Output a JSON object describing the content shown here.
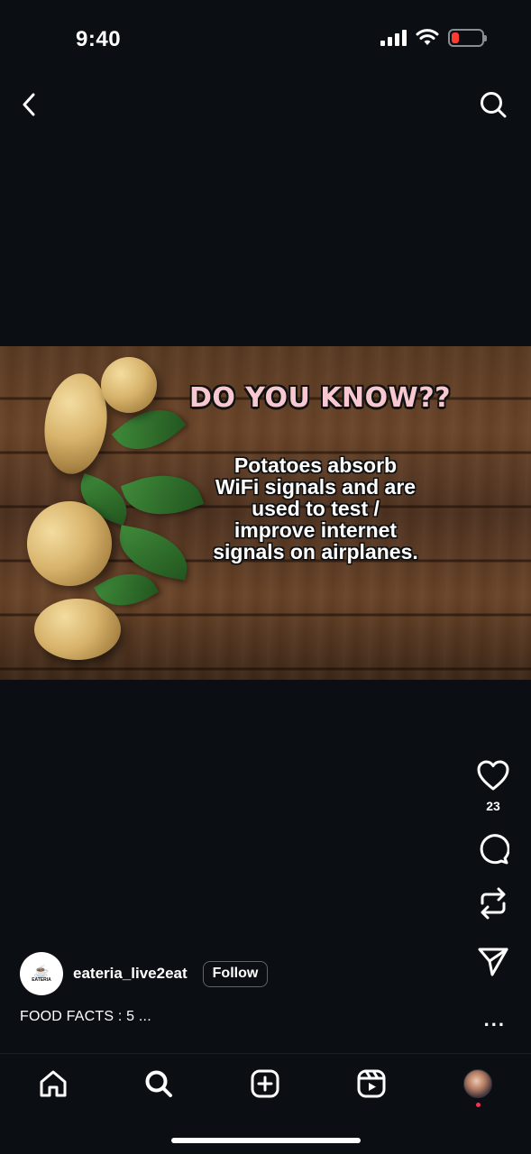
{
  "status_bar": {
    "time": "9:40",
    "icons": [
      "cellular-signal-icon",
      "wifi-icon",
      "battery-low-icon"
    ],
    "battery_color": "#ff3b30"
  },
  "top_nav": {
    "icons": [
      "chevron-left-icon",
      "search-icon"
    ]
  },
  "post_image": {
    "headline": "DO YOU KNOW??",
    "fact": "Potatoes absorb WiFi signals and are used to test / improve internet signals on airplanes.",
    "headline_color": "#f7c8cf"
  },
  "actions": {
    "like_count": "23",
    "icons": [
      "heart-icon",
      "comment-icon",
      "repost-icon",
      "send-icon"
    ]
  },
  "author": {
    "username": "eateria_live2eat",
    "follow_label": "Follow",
    "avatar_text": "EATERIA"
  },
  "caption": "FOOD FACTS : 5 ...",
  "more_label": "...",
  "tab_bar": {
    "icons": [
      "home-icon",
      "search-icon",
      "create-icon",
      "reels-icon",
      "profile-icon"
    ],
    "notification_color": "#ff2d55"
  }
}
